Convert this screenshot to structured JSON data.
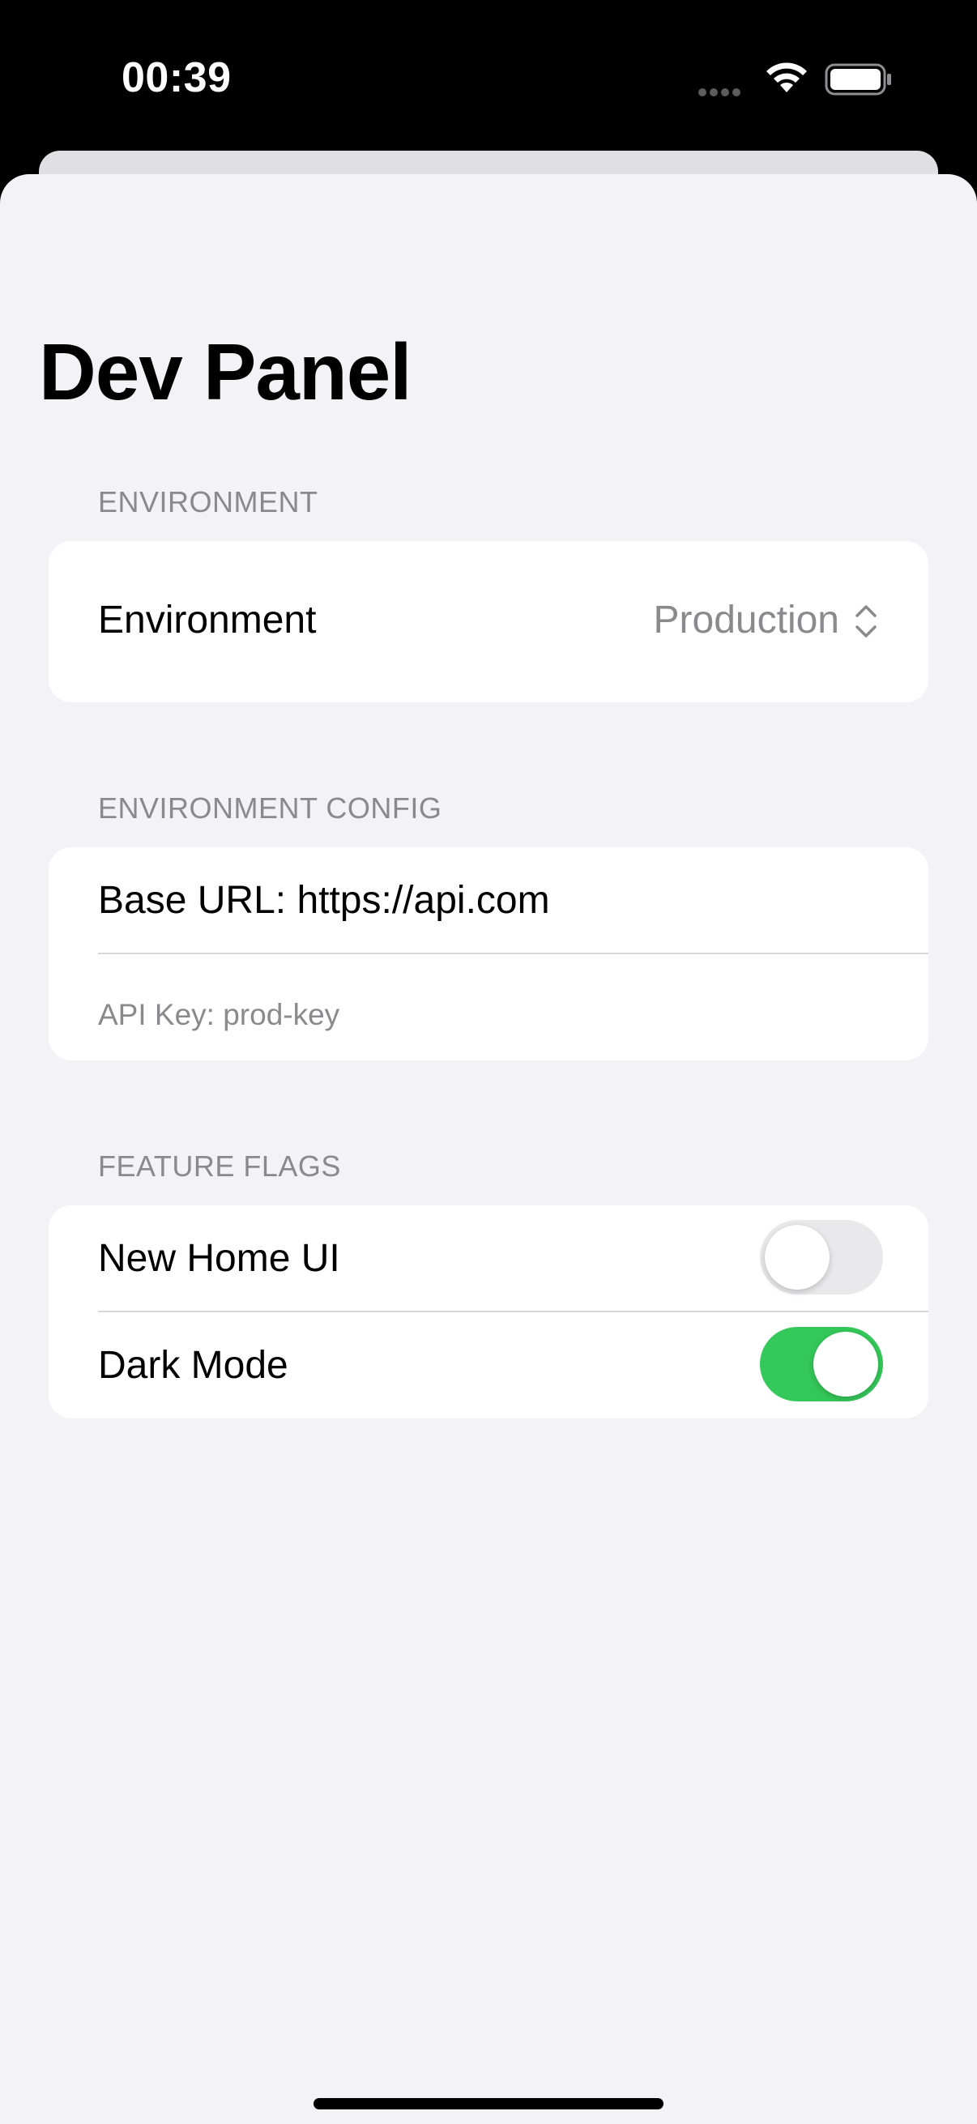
{
  "status_bar": {
    "time": "00:39",
    "signal_icon": "cellular-dots-icon",
    "wifi_icon": "wifi-icon",
    "battery_icon": "battery-icon"
  },
  "sheet": {
    "title": "Dev Panel"
  },
  "sections": {
    "environment": {
      "header": "ENVIRONMENT",
      "row_label": "Environment",
      "picker_value": "Production",
      "picker_icon": "chevron-up-down-icon"
    },
    "environment_config": {
      "header": "ENVIRONMENT CONFIG",
      "base_url": "Base URL: https://api.com",
      "api_key": "API Key: prod-key"
    },
    "feature_flags": {
      "header": "FEATURE FLAGS",
      "flags": [
        {
          "label": "New Home UI",
          "enabled": false
        },
        {
          "label": "Dark Mode",
          "enabled": true
        }
      ]
    }
  },
  "colors": {
    "accent_on": "#34c759",
    "toggle_off": "#e9e9eb",
    "background": "#f2f2f7",
    "secondary_text": "#8a8a8e"
  }
}
